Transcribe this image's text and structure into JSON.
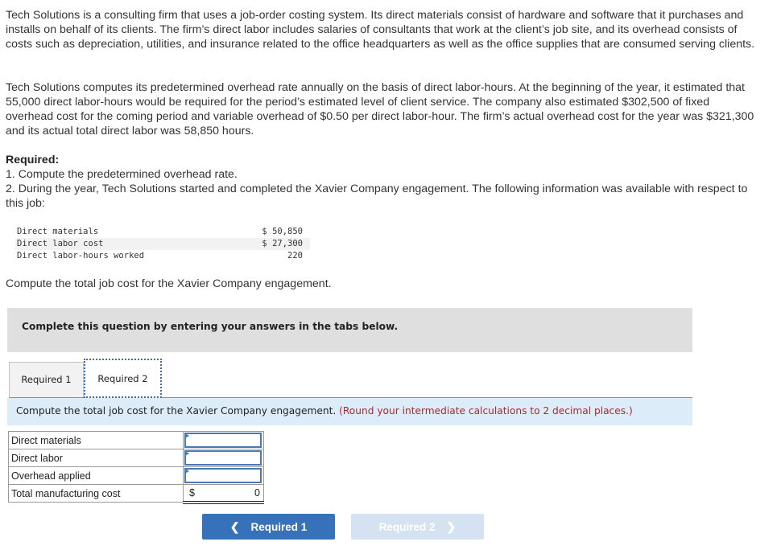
{
  "problem": {
    "paragraph1": "Tech Solutions is a consulting firm that uses a job-order costing system. Its direct materials consist of hardware and software that it purchases and installs on behalf of its clients. The firm’s direct labor includes salaries of consultants that work at the client’s job site, and its overhead consists of costs such as depreciation, utilities, and insurance related to the office headquarters as well as the office supplies that are consumed serving clients.",
    "paragraph2": "Tech Solutions computes its predetermined overhead rate annually on the basis of direct labor-hours. At the beginning of the year, it estimated that 55,000 direct labor-hours would be required for the period’s estimated level of client service. The company also estimated $302,500 of fixed overhead cost for the coming period and variable overhead of $0.50 per direct labor-hour. The firm’s actual overhead cost for the year was $321,300 and its actual total direct labor was 58,850 hours.",
    "required_heading": "Required:",
    "required_1": "1. Compute the predetermined overhead rate.",
    "required_2": "2. During the year, Tech Solutions started and completed the Xavier Company engagement. The following information was available with respect to this job:",
    "given_data": [
      {
        "label": "Direct materials",
        "value": "$ 50,850"
      },
      {
        "label": "Direct labor cost",
        "value": "$ 27,300"
      },
      {
        "label": "Direct labor-hours worked",
        "value": "220"
      }
    ],
    "compute_prompt": "Compute the total job cost for the Xavier Company engagement."
  },
  "instructions": "Complete this question by entering your answers in the tabs below.",
  "tabs": [
    {
      "label": "Required 1",
      "active": false
    },
    {
      "label": "Required 2",
      "active": true
    }
  ],
  "question": {
    "text": "Compute the total job cost for the Xavier Company engagement.",
    "hint": "(Round your intermediate calculations to 2 decimal places.)"
  },
  "answer_table": {
    "rows": [
      {
        "label": "Direct materials",
        "value": ""
      },
      {
        "label": "Direct labor",
        "value": ""
      },
      {
        "label": "Overhead applied",
        "value": ""
      }
    ],
    "total": {
      "label": "Total manufacturing cost",
      "currency": "$",
      "value": "0"
    }
  },
  "navigation": {
    "prev_label": "Required 1",
    "prev_icon": "chevron-left-icon",
    "next_label": "Required 2",
    "next_icon": "chevron-right-icon",
    "next_disabled": true
  },
  "colors": {
    "primary_button": "#3671b9",
    "disabled_button": "#d5e2f1",
    "hint_red": "#b0262d",
    "question_bar": "#dcecf9",
    "instructions_bg": "#dfdfdf"
  }
}
